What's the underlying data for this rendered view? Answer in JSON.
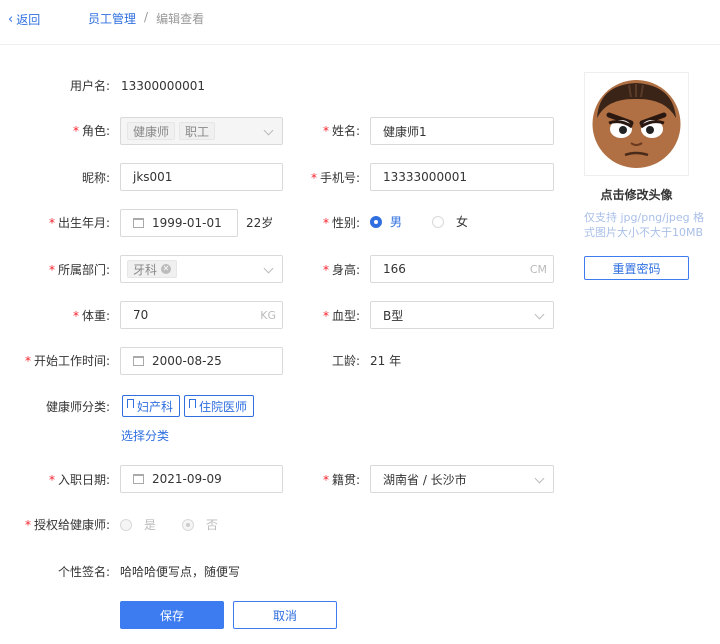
{
  "nav": {
    "back_label": "返回",
    "breadcrumb_parent": "员工管理",
    "breadcrumb_sep": "/",
    "breadcrumb_current": "编辑查看"
  },
  "form": {
    "username": {
      "label": "用户名:",
      "value": "13300000001"
    },
    "role": {
      "label": "角色:",
      "tags": [
        "健康师",
        "职工"
      ]
    },
    "name": {
      "label": "姓名:",
      "value": "健康师1"
    },
    "nickname": {
      "label": "昵称:",
      "value": "jks001"
    },
    "phone": {
      "label": "手机号:",
      "value": "13333000001"
    },
    "birth": {
      "label": "出生年月:",
      "value": "1999-01-01",
      "age": "22岁"
    },
    "gender": {
      "label": "性别:",
      "options": [
        "男",
        "女"
      ],
      "selected": "男"
    },
    "department": {
      "label": "所属部门:",
      "tags": [
        "牙科"
      ]
    },
    "height": {
      "label": "身高:",
      "value": "166",
      "unit": "CM"
    },
    "weight": {
      "label": "体重:",
      "value": "70",
      "unit": "KG"
    },
    "blood": {
      "label": "血型:",
      "value": "B型"
    },
    "work_start": {
      "label": "开始工作时间:",
      "value": "2000-08-25"
    },
    "seniority": {
      "label": "工龄:",
      "value": "21 年"
    },
    "category": {
      "label": "健康师分类:",
      "tags": [
        "妇产科",
        "住院医师"
      ],
      "select_link": "选择分类"
    },
    "hire_date": {
      "label": "入职日期:",
      "value": "2021-09-09"
    },
    "origin": {
      "label": "籍贯:",
      "value": "湖南省 / 长沙市"
    },
    "authorize": {
      "label": "授权给健康师:",
      "options": [
        "是",
        "否"
      ],
      "selected": "否"
    },
    "signature": {
      "label": "个性签名:",
      "value": "哈哈哈便写点，随便写"
    }
  },
  "avatar": {
    "caption": "点击修改头像",
    "hint": "仅支持 jpg/png/jpeg 格式图片大小不大于10MB",
    "reset_label": "重置密码"
  },
  "actions": {
    "save_label": "保存",
    "cancel_label": "取消"
  },
  "colors": {
    "accent": "#2f6fe0",
    "required": "#f5222d",
    "primary_button": "#3d7cf0"
  }
}
